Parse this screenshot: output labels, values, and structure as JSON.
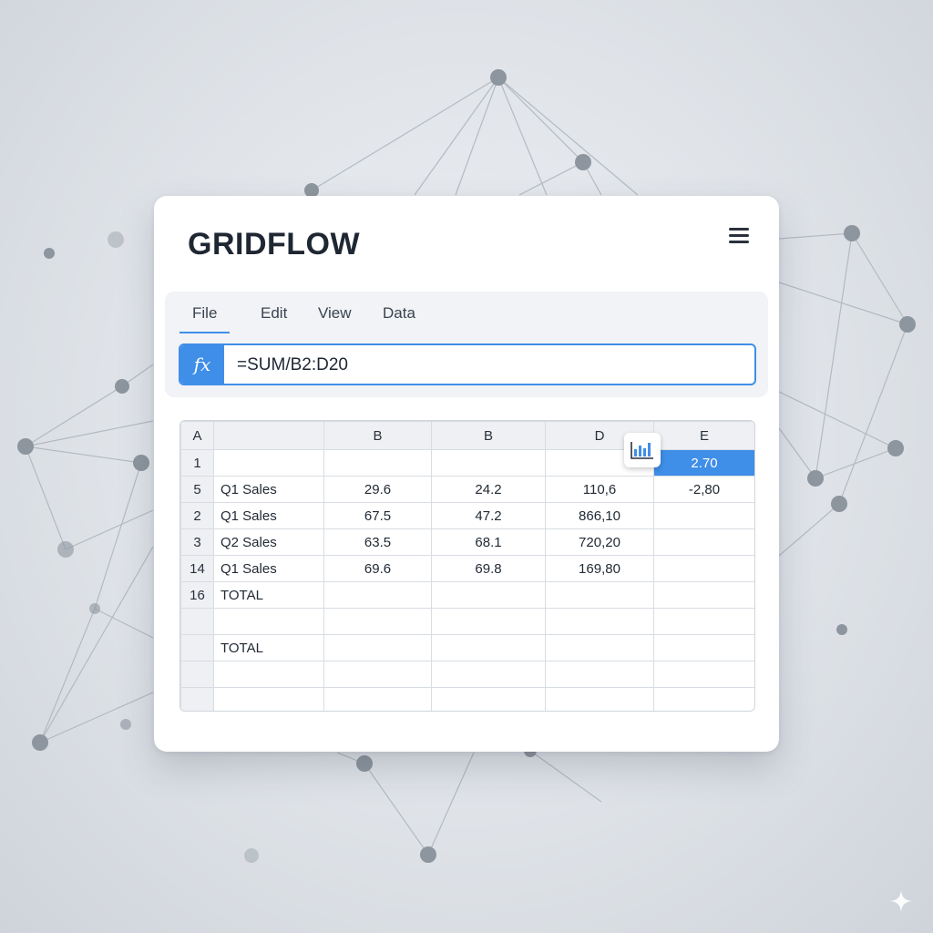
{
  "app": {
    "title": "GRIDFLOW"
  },
  "menu": {
    "tabs": [
      "File",
      "Edit",
      "View",
      "Data"
    ],
    "active_tab": "File"
  },
  "formula_bar": {
    "fx_label": "fx",
    "value": "=SUM/B2:D20"
  },
  "grid": {
    "column_headers": [
      "A",
      "",
      "B",
      "B",
      "D",
      "E"
    ],
    "rows": [
      {
        "num": "1",
        "label": "",
        "c1": "",
        "c2": "",
        "c3": "",
        "c4": "2.70"
      },
      {
        "num": "5",
        "label": "Q1 Sales",
        "c1": "29.6",
        "c2": "24.2",
        "c3": "110,6",
        "c4": "-2,80"
      },
      {
        "num": "2",
        "label": "Q1 Sales",
        "c1": "67.5",
        "c2": "47.2",
        "c3": "866,10",
        "c4": ""
      },
      {
        "num": "3",
        "label": "Q2 Sales",
        "c1": "63.5",
        "c2": "68.1",
        "c3": "720,20",
        "c4": ""
      },
      {
        "num": "14",
        "label": "Q1 Sales",
        "c1": "69.6",
        "c2": "69.8",
        "c3": "169,80",
        "c4": ""
      },
      {
        "num": "16",
        "label": "TOTAL",
        "c1": "",
        "c2": "",
        "c3": "",
        "c4": ""
      },
      {
        "num": "",
        "label": "",
        "c1": "",
        "c2": "",
        "c3": "",
        "c4": ""
      },
      {
        "num": "",
        "label": "TOTAL",
        "c1": "",
        "c2": "",
        "c3": "",
        "c4": ""
      },
      {
        "num": "",
        "label": "",
        "c1": "",
        "c2": "",
        "c3": "",
        "c4": ""
      },
      {
        "num": "",
        "label": "",
        "c1": "",
        "c2": "",
        "c3": "",
        "c4": ""
      }
    ],
    "selected_cell": "E1"
  },
  "icons": {
    "menu": "hamburger-icon",
    "chart": "bar-chart-icon",
    "fx": "function-icon",
    "sparkle": "sparkle-icon"
  },
  "colors": {
    "accent": "#3f8ee8",
    "title": "#1f2733",
    "background": "#dfe3e8"
  }
}
